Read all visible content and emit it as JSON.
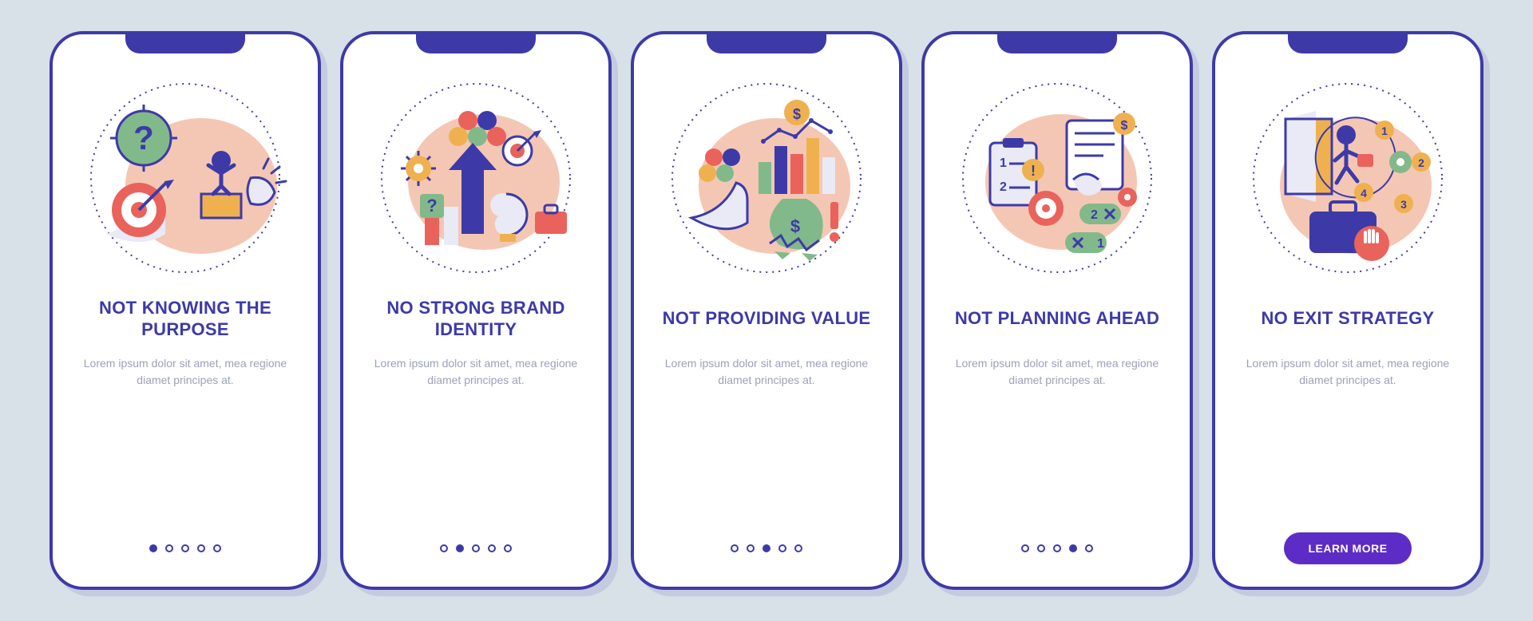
{
  "lorem": "Lorem ipsum dolor sit amet, mea regione diamet principes at.",
  "cta_label": "LEARN MORE",
  "total_slides": 5,
  "colors": {
    "navy": "#3d3aa8",
    "red": "#e9635c",
    "green": "#82b98a",
    "yellow": "#efb14f",
    "peach": "#f4c7b4",
    "light_bg": "#d8e0e8",
    "cta_purple": "#5d2cc6"
  },
  "slides": [
    {
      "title": "Not Knowing The Purpose",
      "icon": "purpose-icon",
      "active_dot": 0,
      "has_cta": false
    },
    {
      "title": "No Strong Brand Identity",
      "icon": "brand-icon",
      "active_dot": 1,
      "has_cta": false
    },
    {
      "title": "Not Providing Value",
      "icon": "value-icon",
      "active_dot": 2,
      "has_cta": false
    },
    {
      "title": "Not Planning Ahead",
      "icon": "planning-icon",
      "active_dot": 3,
      "has_cta": false
    },
    {
      "title": "No Exit Strategy",
      "icon": "exit-icon",
      "active_dot": 4,
      "has_cta": true
    }
  ]
}
